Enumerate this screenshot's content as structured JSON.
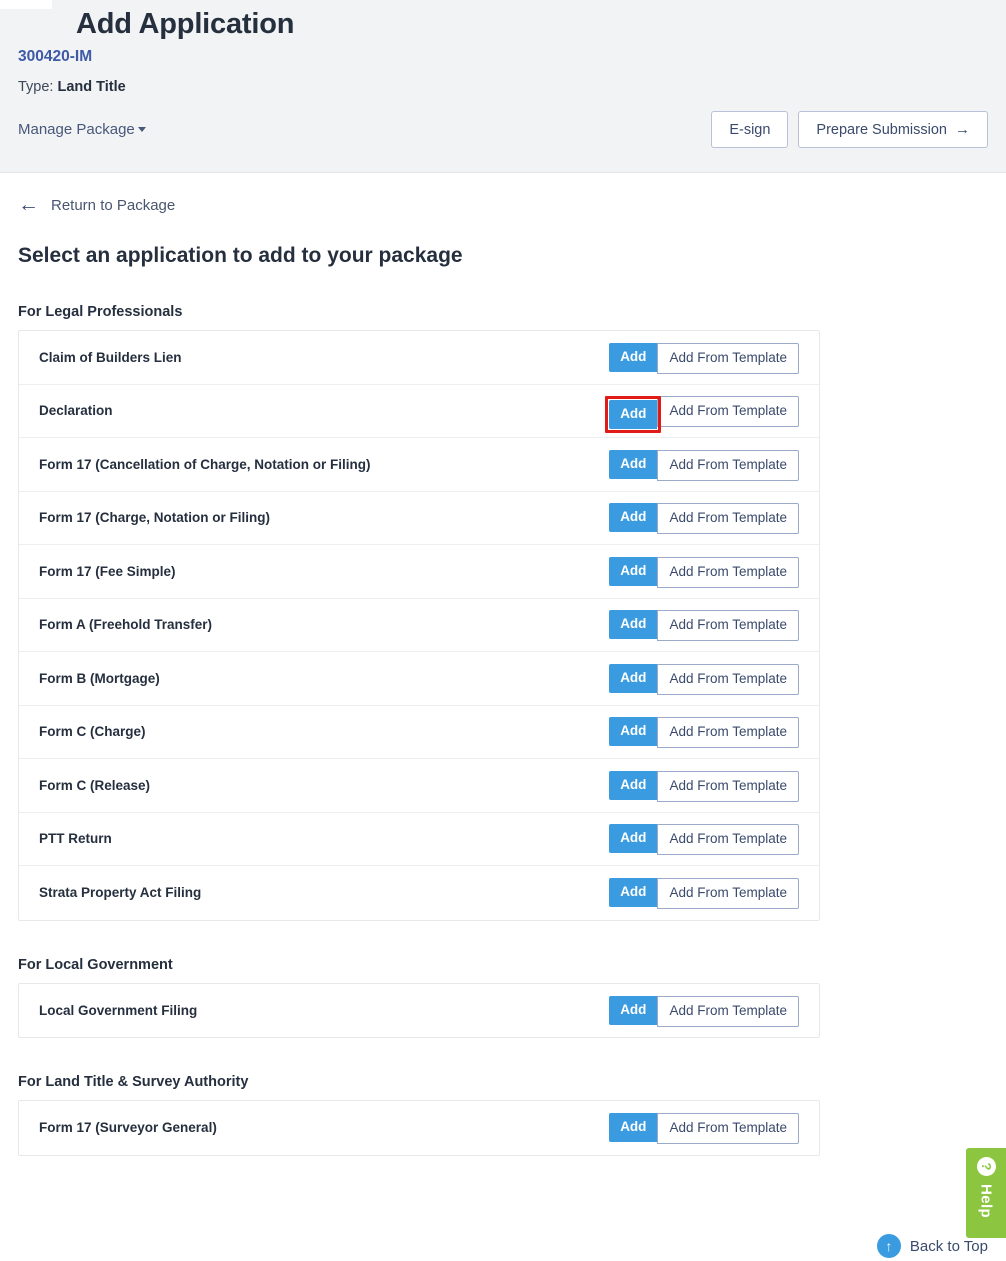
{
  "header": {
    "title": "Add Application",
    "package_id": "300420-IM",
    "type_label": "Type:",
    "type_value": "Land Title",
    "manage_package_label": "Manage Package",
    "esign_label": "E-sign",
    "prepare_submission_label": "Prepare Submission",
    "prepare_submission_arrow": "→",
    "caret_icon": "chevron-down-icon"
  },
  "main": {
    "return_link_label": "Return to Package",
    "return_arrow_icon": "←",
    "section_heading": "Select an application to add to your package",
    "button_labels": {
      "add": "Add",
      "add_from_template": "Add From Template"
    },
    "groups": [
      {
        "label": "For Legal Professionals",
        "rows": [
          {
            "name": "Claim of Builders Lien",
            "highlighted": false
          },
          {
            "name": "Declaration",
            "highlighted": true
          },
          {
            "name": "Form 17 (Cancellation of Charge, Notation or Filing)",
            "highlighted": false
          },
          {
            "name": "Form 17 (Charge, Notation or Filing)",
            "highlighted": false
          },
          {
            "name": "Form 17 (Fee Simple)",
            "highlighted": false
          },
          {
            "name": "Form A (Freehold Transfer)",
            "highlighted": false
          },
          {
            "name": "Form B (Mortgage)",
            "highlighted": false
          },
          {
            "name": "Form C (Charge)",
            "highlighted": false
          },
          {
            "name": "Form C (Release)",
            "highlighted": false
          },
          {
            "name": "PTT Return",
            "highlighted": false
          },
          {
            "name": "Strata Property Act Filing",
            "highlighted": false
          }
        ]
      },
      {
        "label": "For Local Government",
        "rows": [
          {
            "name": "Local Government Filing",
            "highlighted": false
          }
        ]
      },
      {
        "label": "For Land Title & Survey Authority",
        "rows": [
          {
            "name": "Form 17 (Surveyor General)",
            "highlighted": false
          }
        ]
      }
    ]
  },
  "widgets": {
    "help_label": "Help",
    "help_icon": "question-mark-icon",
    "back_to_top_label": "Back to Top",
    "back_to_top_icon": "↑"
  },
  "colors": {
    "accent_blue": "#3a9be0",
    "link_navy": "#3f5aa6",
    "help_green": "#8cc540",
    "highlight_red": "#e01b18",
    "header_bg": "#f1f3f5"
  }
}
